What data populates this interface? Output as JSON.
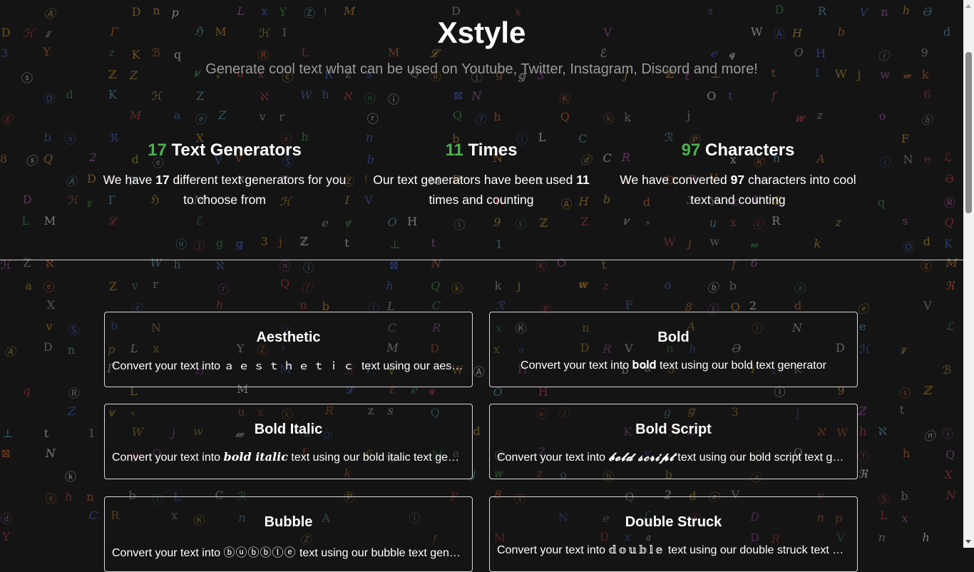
{
  "header": {
    "title": "Xstyle",
    "subtitle": "Generate cool text what can be used on Youtube, Twitter, Instagram, Discord and more!"
  },
  "stats": [
    {
      "number": "17",
      "label": "Text Generators",
      "pre": "We have ",
      "value": "17",
      "post": " different text generators for you to choose from"
    },
    {
      "number": "11",
      "label": "Times",
      "pre": "Our text generators have been used ",
      "value": "11",
      "post": " times and counting"
    },
    {
      "number": "97",
      "label": "Characters",
      "pre": "We have converted ",
      "value": "97",
      "post": " characters into cool text and counting"
    }
  ],
  "cards": [
    {
      "title": "Aesthetic",
      "pre": "Convert your text into ",
      "example": "ａｅｓｔｈｅｔｉｃ",
      "post": " text using our aesthetic text generator"
    },
    {
      "title": "Bold",
      "pre": "Convert your text into ",
      "example": "𝐛𝐨𝐥𝐝",
      "post": " text using our bold text generator"
    },
    {
      "title": "Bold Italic",
      "pre": "Convert your text into ",
      "example": "𝒃𝒐𝒍𝒅 𝒊𝒕𝒂𝒍𝒊𝒄",
      "post": " text using our bold italic text generator"
    },
    {
      "title": "Bold Script",
      "pre": "Convert your text into ",
      "example": "𝓫𝓸𝓵𝓭 𝓼𝓬𝓻𝓲𝓹𝓽",
      "post": " text using our bold script text generator"
    },
    {
      "title": "Bubble",
      "pre": "Convert your text into ",
      "example": "ⓑⓤⓑⓑⓛⓔ",
      "post": " text using our bubble text generator"
    },
    {
      "title": "Double Struck",
      "pre": "Convert your text into ",
      "example": "𝕕𝕠𝕦𝕓𝕝𝕖",
      "post": " text using our double struck text generator"
    }
  ],
  "colors": {
    "accent": "#4caf50",
    "background": "#141414",
    "subtitle": "#9a9a9a",
    "card_border": "#d8d8d8"
  },
  "background_glyphs": "ⒶDnpLxYⓏ𝔣MDx𝔞DRVnhƏDℋ𝔃ΓℌMℋIVWⒶHbd3YzKℬqⓇLM𝓛ℰℯ𝓺OHⓘ9ⓢℤZ𝒗ₛuxⓒRzsQⓤⓙg𝕘3jℤt⊥t1Wjw𝔀kⓄdKℋZℵWhℵⓝⓘ⊠NⓀOtf6ⓖMaⓔZvrⓡQⓕhQⓚkj𝒘zoⓑbⓐℜXⓔhnbⓘLCℛⓅF8ⓢQ2dⓔVvⓈbNⓓCRxⓀnAⓘNeℒ"
}
